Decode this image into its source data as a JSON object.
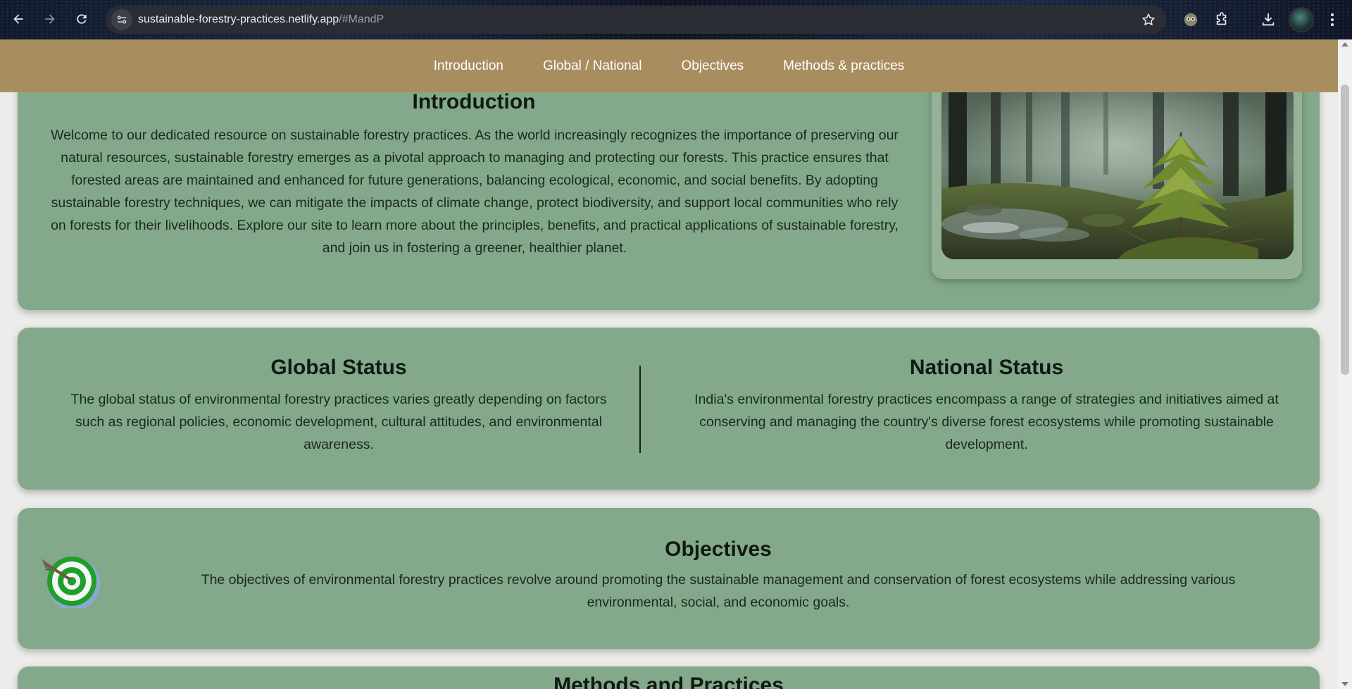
{
  "browser": {
    "url_host": "sustainable-forestry-practices.netlify.app",
    "url_hash": "/#MandP",
    "icons": [
      "back-icon",
      "forward-icon",
      "reload-icon",
      "site-info-icon",
      "bookmark-star-icon",
      "extension-icon",
      "puzzle-icon",
      "download-icon",
      "profile-avatar",
      "more-menu-icon"
    ]
  },
  "nav": {
    "items": [
      {
        "label": "Introduction"
      },
      {
        "label": "Global / National"
      },
      {
        "label": "Objectives"
      },
      {
        "label": "Methods & practices"
      }
    ]
  },
  "intro": {
    "title": "Introduction",
    "text": "Welcome to our dedicated resource on sustainable forestry practices. As the world increasingly recognizes the importance of preserving our natural resources, sustainable forestry emerges as a pivotal approach to managing and protecting our forests. This practice ensures that forested areas are maintained and enhanced for future generations, balancing ecological, economic, and social benefits. By adopting sustainable forestry techniques, we can mitigate the impacts of climate change, protect biodiversity, and support local communities who rely on forests for their livelihoods. Explore our site to learn more about the principles, benefits, and practical applications of sustainable forestry, and join us in fostering a greener, healthier planet.",
    "image_icon": "forest-seedling-photo"
  },
  "status": {
    "global": {
      "title": "Global Status",
      "text": "The global status of environmental forestry practices varies greatly depending on factors such as regional policies, economic development, cultural attitudes, and environmental awareness."
    },
    "national": {
      "title": "National Status",
      "text": "India's environmental forestry practices encompass a range of strategies and initiatives aimed at conserving and managing the country's diverse forest ecosystems while promoting sustainable development."
    }
  },
  "objectives": {
    "title": "Objectives",
    "text": "The objectives of environmental forestry practices revolve around promoting the sustainable management and conservation of forest ecosystems while addressing various environmental, social, and economic goals.",
    "icon": "target-dart-icon"
  },
  "methods": {
    "title": "Methods and Practices"
  },
  "colors": {
    "nav_bg": "#a88d5e",
    "card_bg": "#83a98a",
    "page_bg": "#ececea"
  }
}
